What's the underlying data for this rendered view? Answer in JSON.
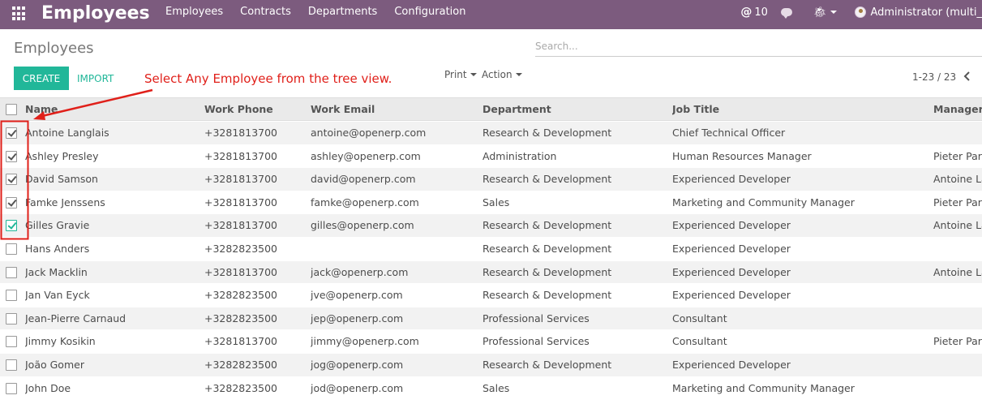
{
  "navbar": {
    "app_title": "Employees",
    "menu": [
      "Employees",
      "Contracts",
      "Departments",
      "Configuration"
    ],
    "messages_count": "10",
    "user_name": "Administrator (multi_"
  },
  "control_panel": {
    "breadcrumb": "Employees",
    "search_placeholder": "Search...",
    "create_label": "CREATE",
    "import_label": "IMPORT",
    "print_label": "Print",
    "action_label": "Action",
    "pager": "1-23 / 23"
  },
  "annotation": {
    "text": "Select Any Employee from the tree view.",
    "color": "#e0201a"
  },
  "table": {
    "headers": [
      "Name",
      "Work Phone",
      "Work Email",
      "Department",
      "Job Title",
      "Manager"
    ],
    "rows": [
      {
        "checked": true,
        "name": "Antoine Langlais",
        "phone": "+3281813700",
        "email": "antoine@openerp.com",
        "department": "Research & Development",
        "job": "Chief Technical Officer",
        "manager": ""
      },
      {
        "checked": true,
        "name": "Ashley Presley",
        "phone": "+3281813700",
        "email": "ashley@openerp.com",
        "department": "Administration",
        "job": "Human Resources Manager",
        "manager": "Pieter Park"
      },
      {
        "checked": true,
        "name": "David Samson",
        "phone": "+3281813700",
        "email": "david@openerp.com",
        "department": "Research & Development",
        "job": "Experienced Developer",
        "manager": "Antoine La"
      },
      {
        "checked": true,
        "name": "Famke Jenssens",
        "phone": "+3281813700",
        "email": "famke@openerp.com",
        "department": "Sales",
        "job": "Marketing and Community Manager",
        "manager": "Pieter Park"
      },
      {
        "checked": true,
        "name": "Gilles Gravie",
        "phone": "+3281813700",
        "email": "gilles@openerp.com",
        "department": "Research & Development",
        "job": "Experienced Developer",
        "manager": "Antoine La"
      },
      {
        "checked": false,
        "name": "Hans Anders",
        "phone": "+3282823500",
        "email": "",
        "department": "Research & Development",
        "job": "Experienced Developer",
        "manager": ""
      },
      {
        "checked": false,
        "name": "Jack Macklin",
        "phone": "+3281813700",
        "email": "jack@openerp.com",
        "department": "Research & Development",
        "job": "Experienced Developer",
        "manager": "Antoine La"
      },
      {
        "checked": false,
        "name": "Jan Van Eyck",
        "phone": "+3282823500",
        "email": "jve@openerp.com",
        "department": "Research & Development",
        "job": "Experienced Developer",
        "manager": ""
      },
      {
        "checked": false,
        "name": "Jean-Pierre Carnaud",
        "phone": "+3282823500",
        "email": "jep@openerp.com",
        "department": "Professional Services",
        "job": "Consultant",
        "manager": ""
      },
      {
        "checked": false,
        "name": "Jimmy Kosikin",
        "phone": "+3281813700",
        "email": "jimmy@openerp.com",
        "department": "Professional Services",
        "job": "Consultant",
        "manager": "Pieter Park"
      },
      {
        "checked": false,
        "name": "João Gomer",
        "phone": "+3282823500",
        "email": "jog@openerp.com",
        "department": "Research & Development",
        "job": "Experienced Developer",
        "manager": ""
      },
      {
        "checked": false,
        "name": "John Doe",
        "phone": "+3282823500",
        "email": "jod@openerp.com",
        "department": "Sales",
        "job": "Marketing and Community Manager",
        "manager": ""
      }
    ]
  }
}
